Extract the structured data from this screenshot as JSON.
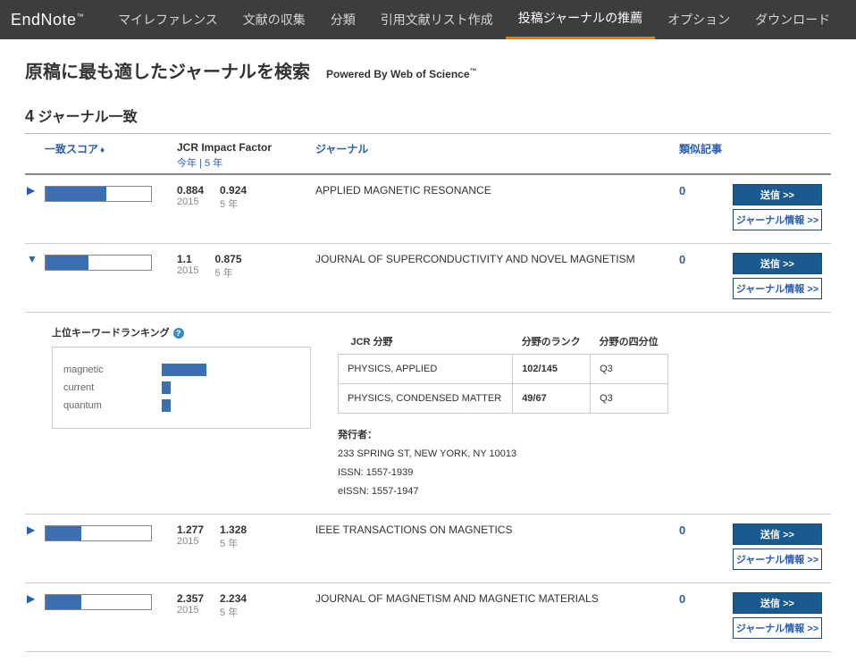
{
  "nav": {
    "logo_main": "EndNote",
    "logo_tm": "™",
    "items": [
      "マイレファレンス",
      "文献の収集",
      "分類",
      "引用文献リスト作成",
      "投稿ジャーナルの推薦",
      "オプション",
      "ダウンロード"
    ],
    "active_index": 4
  },
  "page": {
    "title": "原稿に最も適したジャーナルを検索",
    "powered": "Powered By Web of Science",
    "powered_tm": "™",
    "count_num": "4",
    "count_suffix": "ジャーナル一致"
  },
  "headers": {
    "score": "一致スコア",
    "jcr_main": "JCR Impact Factor",
    "jcr_curr": "今年",
    "jcr_sep": " | ",
    "jcr_5yr": "5 年",
    "journal": "ジャーナル",
    "similar": "類似記事"
  },
  "buttons": {
    "send": "送信 >>",
    "info": "ジャーナル情報 >>"
  },
  "rows": [
    {
      "expanded": false,
      "score_pct": 58,
      "if_curr": "0.884",
      "if_curr_yr": "2015",
      "if_5yr": "0.924",
      "if_5yr_lbl": "5 年",
      "journal": "APPLIED MAGNETIC RESONANCE",
      "similar": "0"
    },
    {
      "expanded": true,
      "score_pct": 41,
      "if_curr": "1.1",
      "if_curr_yr": "2015",
      "if_5yr": "0.875",
      "if_5yr_lbl": "5 年",
      "journal": "JOURNAL OF SUPERCONDUCTIVITY AND NOVEL MAGNETISM",
      "similar": "0"
    },
    {
      "expanded": false,
      "score_pct": 34,
      "if_curr": "1.277",
      "if_curr_yr": "2015",
      "if_5yr": "1.328",
      "if_5yr_lbl": "5 年",
      "journal": "IEEE TRANSACTIONS ON MAGNETICS",
      "similar": "0"
    },
    {
      "expanded": false,
      "score_pct": 34,
      "if_curr": "2.357",
      "if_curr_yr": "2015",
      "if_5yr": "2.234",
      "if_5yr_lbl": "5 年",
      "journal": "JOURNAL OF MAGNETISM AND MAGNETIC MATERIALS",
      "similar": "0"
    }
  ],
  "detail": {
    "kw_title": "上位キーワードランキング",
    "keywords": [
      {
        "label": "magnetic",
        "w": 50
      },
      {
        "label": "current",
        "w": 10
      },
      {
        "label": "quantum",
        "w": 10
      }
    ],
    "jcr_title": "JCR 分野",
    "col_rank": "分野のランク",
    "col_quartile": "分野の四分位",
    "categories": [
      {
        "name": "PHYSICS, APPLIED",
        "rank": "102/145",
        "q": "Q3"
      },
      {
        "name": "PHYSICS, CONDENSED MATTER",
        "rank": "49/67",
        "q": "Q3"
      }
    ],
    "publisher_label": "発行者：",
    "publisher_addr": "233 SPRING ST, NEW YORK, NY 10013",
    "issn_label": "ISSN:",
    "issn": "1557-1939",
    "eissn_label": "eISSN:",
    "eissn": "1557-1947"
  },
  "chart_data": {
    "type": "bar",
    "title": "上位キーワードランキング",
    "categories": [
      "magnetic",
      "current",
      "quantum"
    ],
    "values": [
      50,
      10,
      10
    ],
    "xlabel": "",
    "ylabel": "",
    "ylim": [
      0,
      100
    ]
  }
}
